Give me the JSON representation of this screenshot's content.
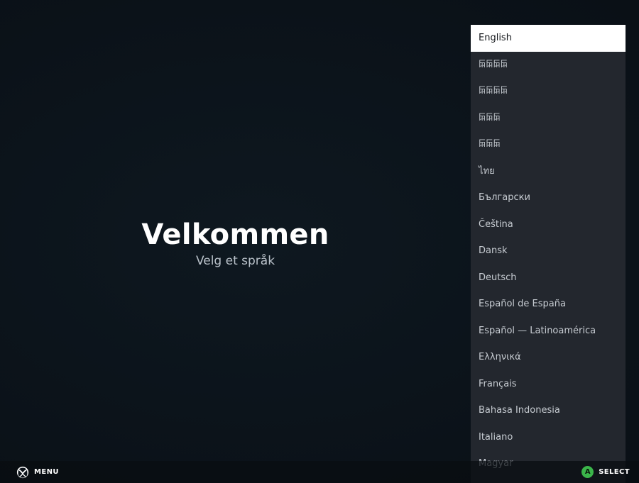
{
  "welcome": {
    "title": "Velkommen",
    "subtitle": "Velg et språk"
  },
  "language_list": {
    "selected_index": 0,
    "items": [
      "English",
      "𐙍𐙍𐙍𐙍",
      "𐙍𐙍𐙍𐙍",
      "𐙍𐙍𐙍",
      "𐙍𐙍𐙍",
      "ไทย",
      "Български",
      "Čeština",
      "Dansk",
      "Deutsch",
      "Español de España",
      "Español — Latinoamérica",
      "Ελληνικά",
      "Français",
      "Bahasa Indonesia",
      "Italiano",
      "Magyar"
    ]
  },
  "footer": {
    "menu_label": "MENU",
    "menu_icon": "xbox-guide-icon",
    "select_label": "SELECT",
    "select_icon": "a-button-icon",
    "select_icon_glyph": "A",
    "select_icon_color": "#3bb54a"
  },
  "colors": {
    "background": "#0c131a",
    "panel": "#23272e",
    "selected_row": "#ffffff"
  }
}
